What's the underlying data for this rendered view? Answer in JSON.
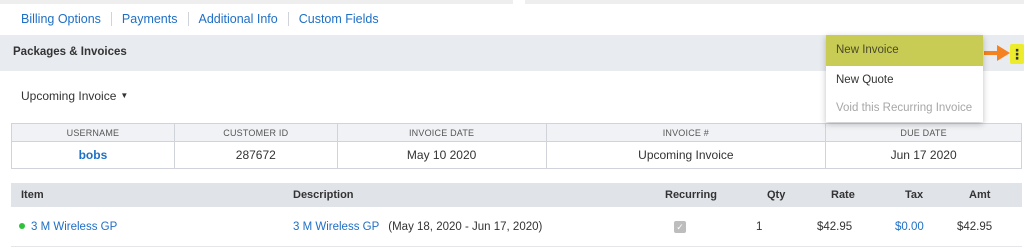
{
  "tabs": [
    "Billing Options",
    "Payments",
    "Additional Info",
    "Custom Fields"
  ],
  "section": {
    "title": "Packages & Invoices"
  },
  "menu": {
    "items": [
      {
        "label": "New Invoice",
        "state": "highlighted"
      },
      {
        "label": "New Quote",
        "state": "normal"
      },
      {
        "label": "Void this Recurring Invoice",
        "state": "disabled"
      }
    ]
  },
  "upcoming_dropdown": {
    "label": "Upcoming Invoice",
    "caret": "▼"
  },
  "info_table": {
    "headers": [
      "USERNAME",
      "CUSTOMER ID",
      "INVOICE DATE",
      "INVOICE #",
      "DUE DATE"
    ],
    "row": [
      "bobs",
      "287672",
      "May 10 2020",
      "Upcoming Invoice",
      "Jun 17 2020"
    ]
  },
  "items_table": {
    "headers": {
      "item": "Item",
      "description": "Description",
      "recurring": "Recurring",
      "qty": "Qty",
      "rate": "Rate",
      "tax": "Tax",
      "amt": "Amt"
    },
    "rows": [
      {
        "item": "3 M Wireless GP",
        "description_link": "3 M Wireless GP",
        "description_period": "(May 18, 2020 - Jun 17, 2020)",
        "recurring": true,
        "qty": "1",
        "rate": "$42.95",
        "tax": "$0.00",
        "amt": "$42.95"
      }
    ]
  },
  "colors": {
    "link": "#1f6fc6",
    "highlight": "#c9cc54",
    "kebab_highlight": "#ecec2c",
    "arrow": "#f58220",
    "status_dot": "#2ec23a"
  },
  "icons": {
    "kebab": "more-vertical-icon",
    "arrow": "arrow-right-icon",
    "status": "status-dot-icon",
    "checkbox": "check-icon"
  }
}
